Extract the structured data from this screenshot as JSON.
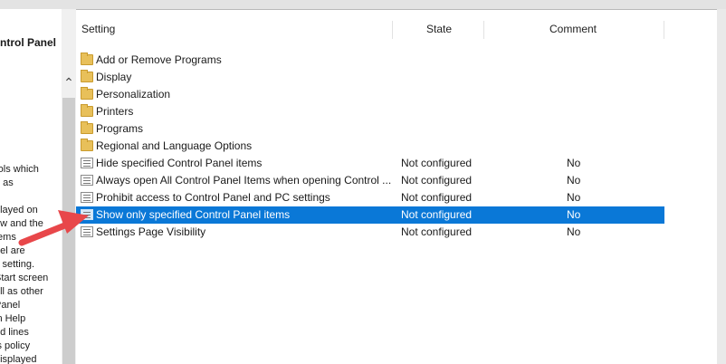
{
  "left_pane": {
    "title": "ntrol Panel",
    "description_lines": [
      "rols which",
      "h as",
      "",
      "played on",
      "ow and the",
      "tems",
      "nel are",
      "s setting.",
      "Start screen",
      "ell as other",
      "Panel",
      "in Help",
      "nd lines",
      "is policy",
      "displayed"
    ]
  },
  "scrollbar": {
    "up_arrow_icon": "chevron-up-icon"
  },
  "columns": {
    "setting": "Setting",
    "state": "State",
    "comment": "Comment"
  },
  "rows": [
    {
      "type": "folder",
      "icon": "folder-icon",
      "name": "Add or Remove Programs",
      "state": "",
      "comment": ""
    },
    {
      "type": "folder",
      "icon": "folder-icon",
      "name": "Display",
      "state": "",
      "comment": ""
    },
    {
      "type": "folder",
      "icon": "folder-icon",
      "name": "Personalization",
      "state": "",
      "comment": ""
    },
    {
      "type": "folder",
      "icon": "folder-icon",
      "name": "Printers",
      "state": "",
      "comment": ""
    },
    {
      "type": "folder",
      "icon": "folder-icon",
      "name": "Programs",
      "state": "",
      "comment": ""
    },
    {
      "type": "folder",
      "icon": "folder-icon",
      "name": "Regional and Language Options",
      "state": "",
      "comment": ""
    },
    {
      "type": "setting",
      "icon": "policy-setting-icon",
      "name": "Hide specified Control Panel items",
      "state": "Not configured",
      "comment": "No"
    },
    {
      "type": "setting",
      "icon": "policy-setting-icon",
      "name": "Always open All Control Panel Items when opening Control ...",
      "state": "Not configured",
      "comment": "No"
    },
    {
      "type": "setting",
      "icon": "policy-setting-icon",
      "name": "Prohibit access to Control Panel and PC settings",
      "state": "Not configured",
      "comment": "No"
    },
    {
      "type": "setting",
      "icon": "policy-setting-icon",
      "name": "Show only specified Control Panel items",
      "state": "Not configured",
      "comment": "No",
      "selected": true
    },
    {
      "type": "setting",
      "icon": "policy-setting-icon",
      "name": "Settings Page Visibility",
      "state": "Not configured",
      "comment": "No"
    }
  ],
  "annotation": {
    "icon": "red-arrow-icon",
    "color": "#e8474a"
  },
  "colors": {
    "selection": "#0a78d7",
    "folder": "#e8c05a"
  }
}
